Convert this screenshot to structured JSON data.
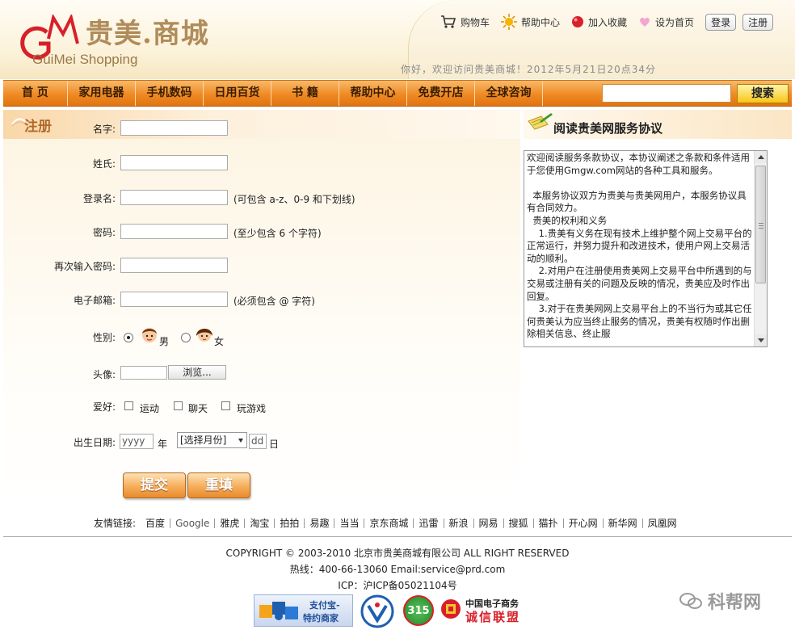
{
  "header": {
    "logo_cn": "贵美.商城",
    "logo_en": "GuiMei Shopping",
    "toplinks": [
      "购物车",
      "帮助中心",
      "加入收藏",
      "设为首页"
    ],
    "login_label": "登录",
    "register_label": "注册",
    "welcome": "你好，欢迎访问贵美商城！2012年5月21日20点34分"
  },
  "nav": {
    "items": [
      "首 页",
      "家用电器",
      "手机数码",
      "日用百货",
      "书 籍",
      "帮助中心",
      "免费开店",
      "全球咨询"
    ],
    "search_placeholder": "",
    "search_label": "搜索"
  },
  "register": {
    "title": "注册",
    "fields": {
      "firstname": "名字:",
      "lastname": "姓氏:",
      "username": "登录名:",
      "username_hint": "(可包含 a-z、0-9 和下划线)",
      "password": "密码:",
      "password_hint": "(至少包含 6 个字符)",
      "password2": "再次输入密码:",
      "email": "电子邮箱:",
      "email_hint": "(必须包含 @ 字符)",
      "gender": "性别:",
      "male": "男",
      "female": "女",
      "avatar": "头像:",
      "browse": "浏览...",
      "hobby": "爱好:",
      "hobbies": [
        "运动",
        "聊天",
        "玩游戏"
      ],
      "birthday": "出生日期:",
      "year_placeholder": "yyyy",
      "year_unit": "年",
      "month_select": "[选择月份]",
      "day_placeholder": "dd",
      "day_unit": "日"
    },
    "submit": "提交",
    "reset": "重填"
  },
  "agreement": {
    "title": "阅读贵美网服务协议",
    "text": "欢迎阅读服务条款协议，本协议阐述之条款和条件适用于您使用Gmgw.com网站的各种工具和服务。\n\n  本服务协议双方为贵美与贵美网用户，本服务协议具有合同效力。\n  贵美的权利和义务\n    1.贵美有义务在现有技术上维护整个网上交易平台的正常运行，并努力提升和改进技术，使用户网上交易活动的顺利。\n    2.对用户在注册使用贵美网上交易平台中所遇到的与交易或注册有关的问题及反映的情况，贵美应及时作出回复。\n    3.对于在贵美网网上交易平台上的不当行为或其它任何贵美认为应当终止服务的情况，贵美有权随时作出删除相关信息、终止服"
  },
  "friends": {
    "label": "友情链接:",
    "links": [
      "百度",
      "Google",
      "雅虎",
      "淘宝",
      "拍拍",
      "易趣",
      "当当",
      "京东商城",
      "迅雷",
      "新浪",
      "网易",
      "搜狐",
      "猫扑",
      "开心网",
      "新华网",
      "凤凰网"
    ]
  },
  "footer": {
    "copyright": "COPYRIGHT © 2003-2010 北京市贵美商城有限公司 ALL RIGHT RESERVED",
    "hotline": "热线：400-66-13060 Email:service@prd.com",
    "icp": "ICP：沪ICP备05021104号",
    "badges": {
      "alipay_line1": "支付宝-",
      "alipay_line2": "特约商家",
      "badge315": "315",
      "credit_line1": "中国电子商务",
      "credit_line2": "诚信联盟"
    }
  },
  "watermark": "科帮网"
}
